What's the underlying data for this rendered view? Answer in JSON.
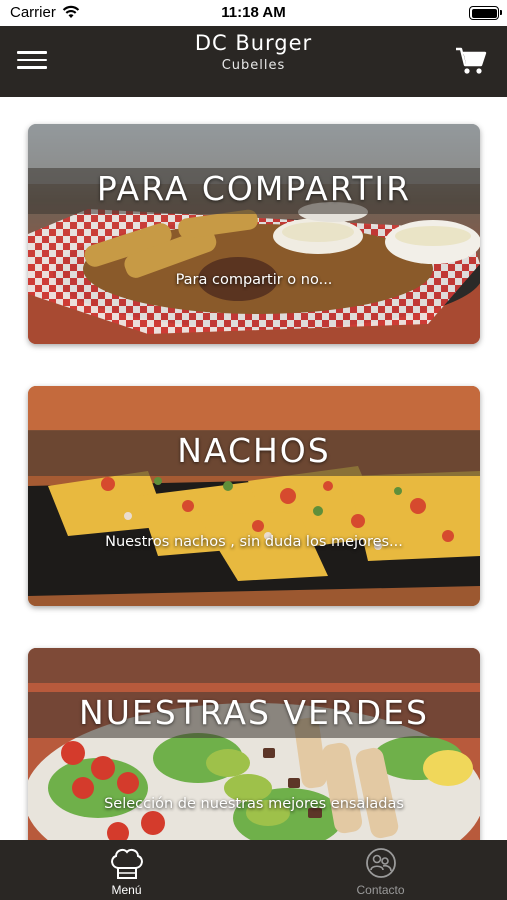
{
  "status_bar": {
    "carrier": "Carrier",
    "time": "11:18 AM",
    "wifi_icon": "wifi-icon",
    "battery_icon": "battery-icon"
  },
  "header": {
    "title": "DC Burger",
    "subtitle": "Cubelles",
    "menu_icon": "hamburger-menu-icon",
    "cart_icon": "shopping-cart-icon",
    "background": "#2a2724"
  },
  "categories": [
    {
      "title": "PARA COMPARTIR",
      "description": "Para compartir o no..."
    },
    {
      "title": "NACHOS",
      "description": "Nuestros nachos , sin duda los mejores..."
    },
    {
      "title": "NUESTRAS VERDES",
      "description": "Selección de nuestras mejores ensaladas"
    }
  ],
  "tab_bar": {
    "tabs": [
      {
        "label": "Menú",
        "icon": "chef-hat-icon",
        "active": true
      },
      {
        "label": "Contacto",
        "icon": "contacts-icon",
        "active": false
      }
    ],
    "active_color": "#ffffff",
    "inactive_color": "#9a9a9a"
  }
}
